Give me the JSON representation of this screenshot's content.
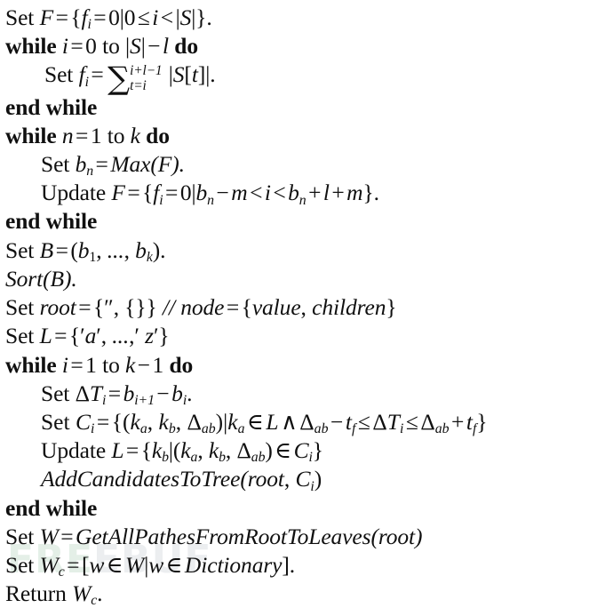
{
  "document": {
    "type": "pseudocode-algorithm",
    "watermark": {
      "text": "FREEBUF",
      "part_green": "FRE",
      "part_gray": "EBUF",
      "color_green": "#e4efe7",
      "color_gray": "#eceef0"
    },
    "background_color": "#ffffff",
    "text_color": "#101010",
    "line_count": 19
  },
  "lines": [
    {
      "id": "line-1",
      "indent": 0,
      "kind": "statement",
      "text": "Set F = {f_i = 0|0 ≤ i < |S|}."
    },
    {
      "id": "line-2",
      "indent": 0,
      "kind": "while-begin",
      "text": "while i = 0 to |S| − l do"
    },
    {
      "id": "line-3",
      "indent": 1,
      "kind": "statement",
      "text": "Set f_i = Σ_{t=i}^{i+l−1} |S[t]|."
    },
    {
      "id": "line-4",
      "indent": 0,
      "kind": "while-end",
      "text": "end while"
    },
    {
      "id": "line-5",
      "indent": 0,
      "kind": "while-begin",
      "text": "while n = 1 to k do"
    },
    {
      "id": "line-6",
      "indent": 1,
      "kind": "statement",
      "text": "Set b_n = Max(F)."
    },
    {
      "id": "line-7",
      "indent": 1,
      "kind": "statement",
      "text": "Update F = {f_i = 0|b_n − m < i < b_n + l + m}."
    },
    {
      "id": "line-8",
      "indent": 0,
      "kind": "while-end",
      "text": "end while"
    },
    {
      "id": "line-9",
      "indent": 0,
      "kind": "statement",
      "text": "Set B = (b_1, ..., b_k)."
    },
    {
      "id": "line-10",
      "indent": 0,
      "kind": "call",
      "text": "Sort(B)."
    },
    {
      "id": "line-11",
      "indent": 0,
      "kind": "statement",
      "text": "Set root = {'', {}} // node = {value, children}"
    },
    {
      "id": "line-12",
      "indent": 0,
      "kind": "statement",
      "text": "Set L = {'a', ...,' z'}"
    },
    {
      "id": "line-13",
      "indent": 0,
      "kind": "while-begin",
      "text": "while i = 1 to k − 1 do"
    },
    {
      "id": "line-14",
      "indent": 1,
      "kind": "statement",
      "text": "Set ΔT_i = b_{i+1} − b_i."
    },
    {
      "id": "line-15",
      "indent": 1,
      "kind": "statement",
      "text": "Set C_i = {(k_a, k_b, Δ_ab)|k_a ∈ L ∧ Δ_ab − t_f ≤ ΔT_i ≤ Δ_ab + t_f}"
    },
    {
      "id": "line-16",
      "indent": 1,
      "kind": "statement",
      "text": "Update L = {k_b|(k_a, k_b, Δ_ab) ∈ C_i}"
    },
    {
      "id": "line-17",
      "indent": 1,
      "kind": "call",
      "text": "AddCandidatesToTree(root, C_i)"
    },
    {
      "id": "line-18",
      "indent": 0,
      "kind": "while-end",
      "text": "end while"
    },
    {
      "id": "line-19a",
      "indent": 0,
      "kind": "statement",
      "text": "Set W = GetAllPathesFromRootToLeaves(root)"
    },
    {
      "id": "line-19b",
      "indent": 0,
      "kind": "statement",
      "text": "Set W_c = [w ∈ W|w ∈ Dictionary]."
    },
    {
      "id": "line-19c",
      "indent": 0,
      "kind": "return",
      "text": "Return W_c."
    }
  ],
  "tokens": {
    "set": "Set",
    "update": "Update",
    "return": "Return",
    "while": "while",
    "end_while": "end while",
    "to": "to",
    "do": "do",
    "zero": "0",
    "one": "1",
    "comment_slashes": "//",
    "sort": "Sort",
    "max": "Max",
    "node": "node",
    "value": "value",
    "children": "children",
    "dictionary": "Dictionary",
    "add_candidates": "AddCandidatesToTree",
    "get_all_pathes": "GetAllPathesFromRootToLeaves",
    "root": "root",
    "letter_a": "a",
    "letter_z": "z",
    "ellipsis": "...",
    "sum_upper": "i+l−1",
    "sum_lower": "t=i"
  }
}
